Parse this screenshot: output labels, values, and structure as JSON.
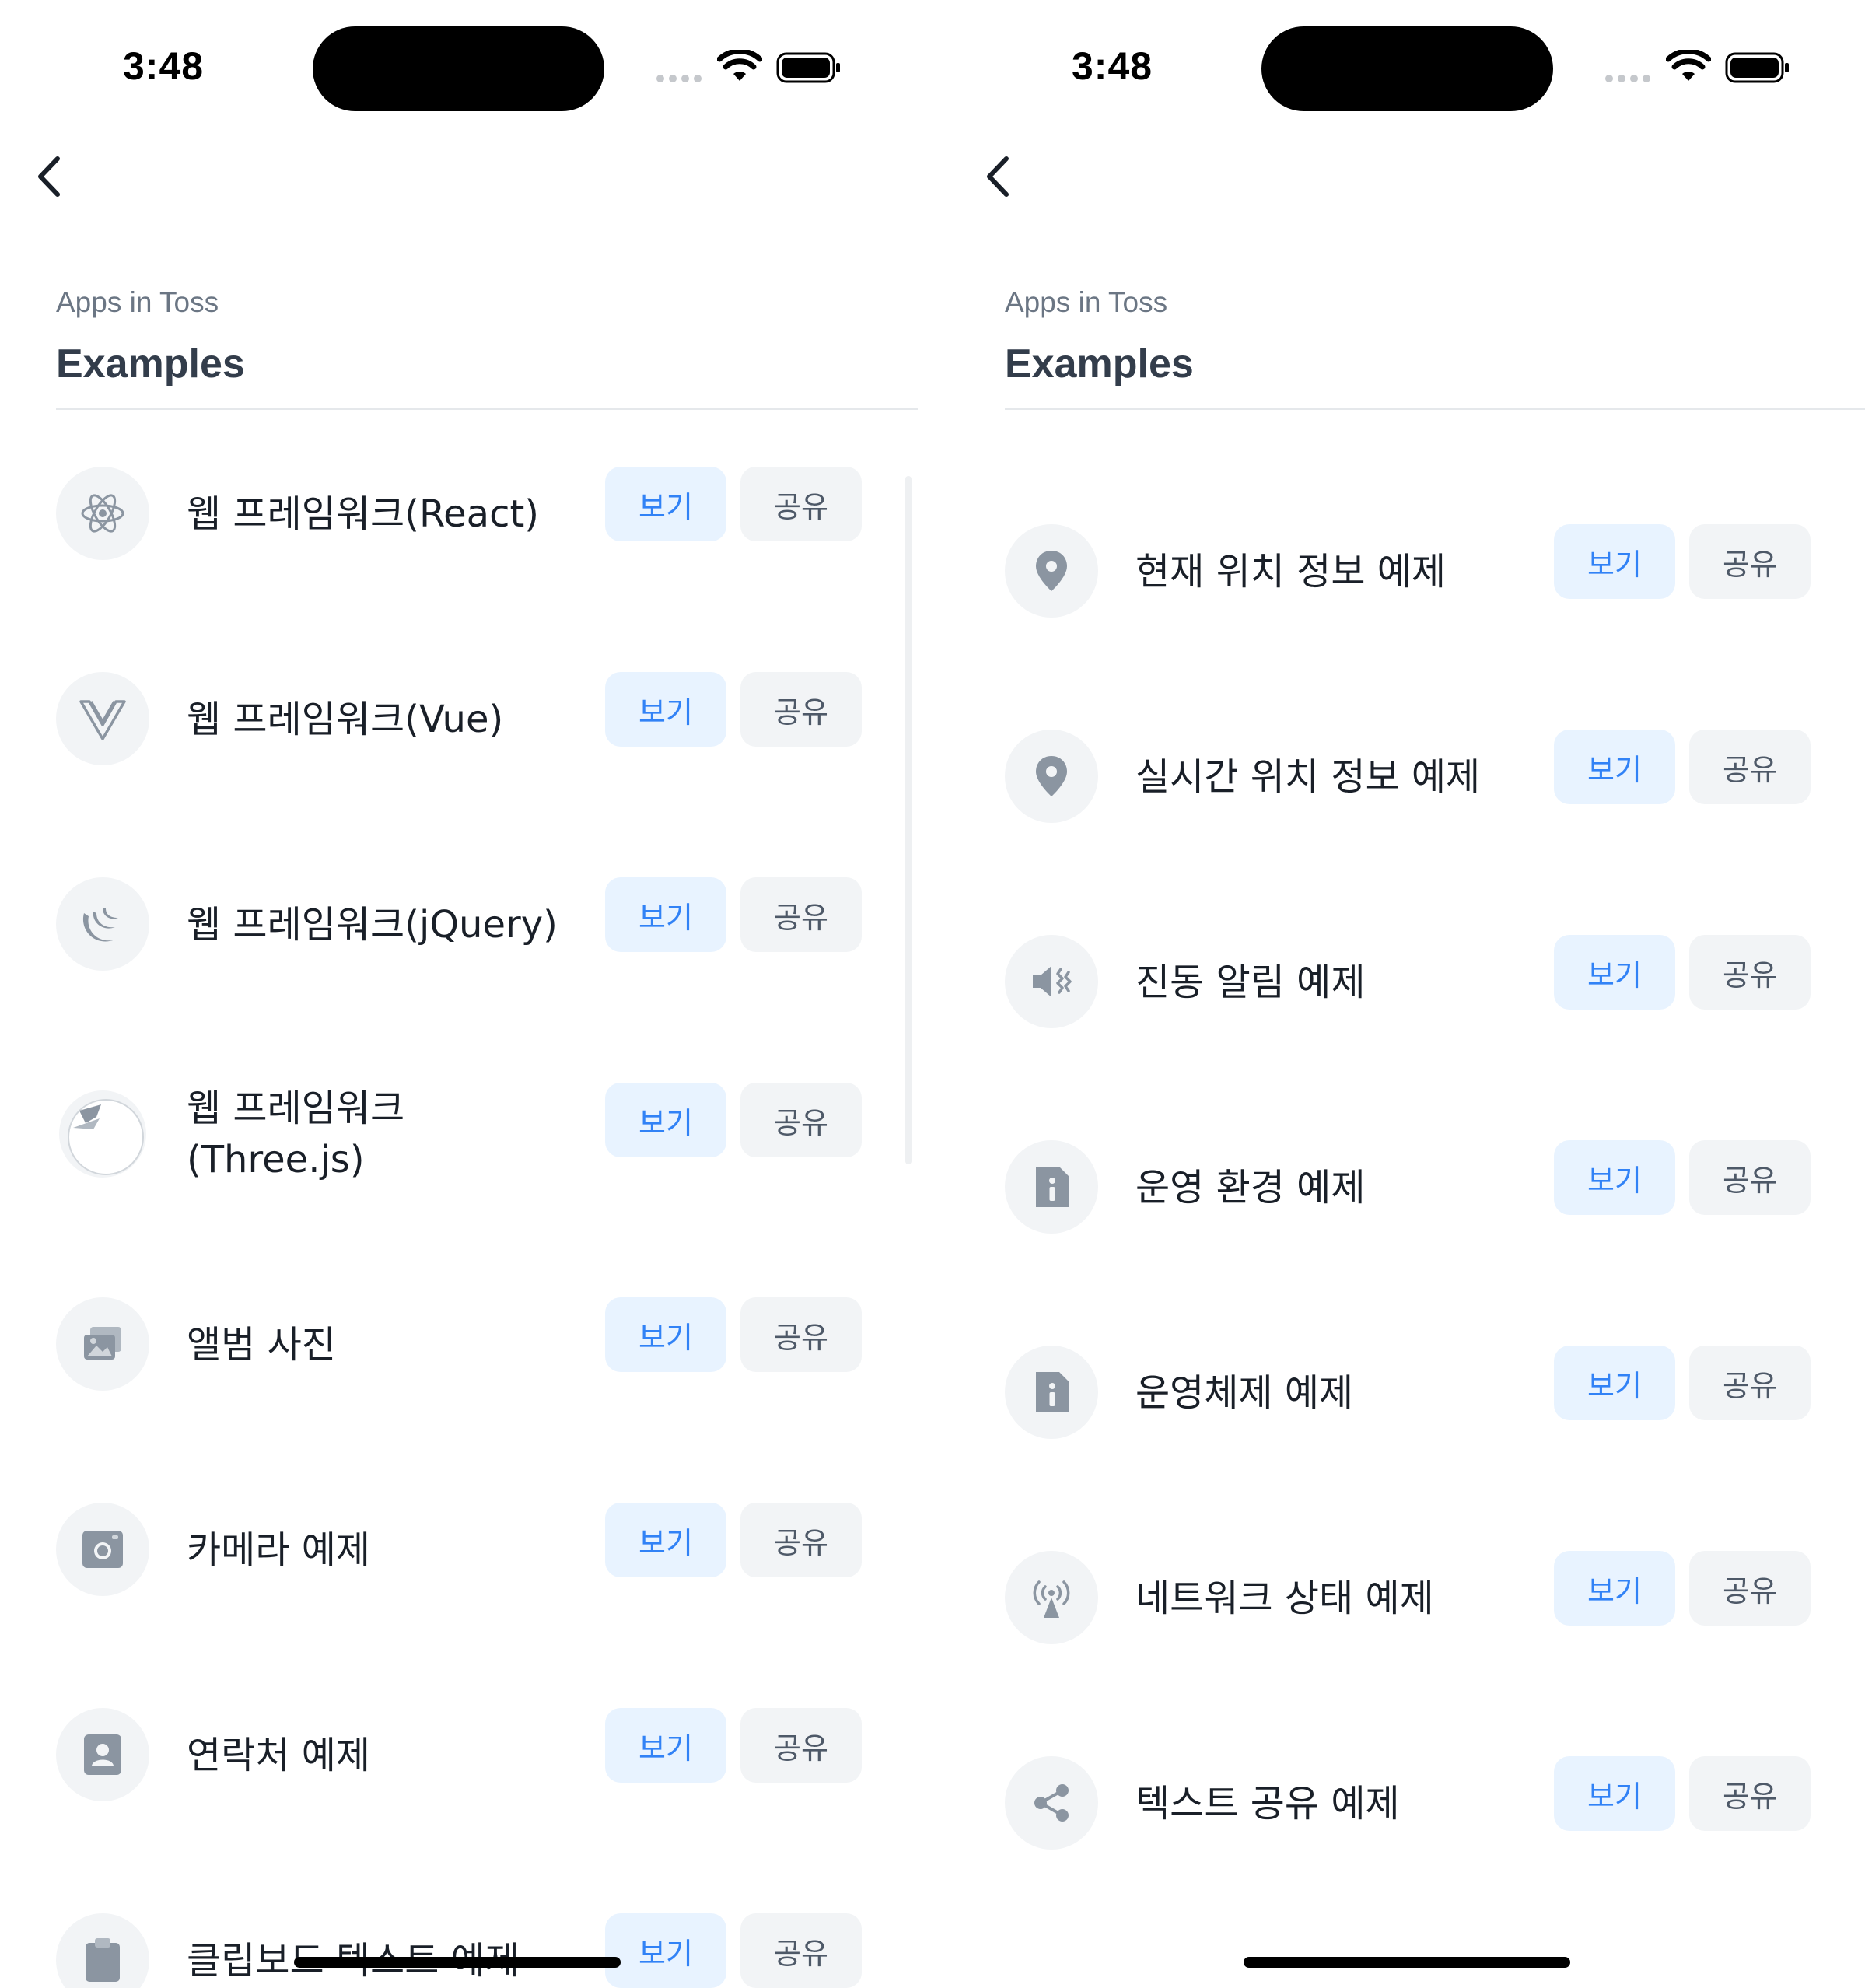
{
  "status": {
    "time": "3:48"
  },
  "header": {
    "subtitle": "Apps in Toss",
    "title": "Examples"
  },
  "buttons": {
    "view": "보기",
    "share": "공유"
  },
  "left": {
    "items": [
      {
        "label": "웹 프레임워크(React)",
        "icon": "react-icon"
      },
      {
        "label": "웹 프레임워크(Vue)",
        "icon": "vue-icon"
      },
      {
        "label": "웹 프레임워크(jQuery)",
        "icon": "jquery-icon"
      },
      {
        "label": "웹 프레임워크\n(Three.js)",
        "icon": "threejs-icon"
      },
      {
        "label": "앨범 사진",
        "icon": "photo-album-icon"
      },
      {
        "label": "카메라 예제",
        "icon": "camera-icon"
      },
      {
        "label": "연락처 예제",
        "icon": "contact-icon"
      },
      {
        "label": "클립보드 텍스트 예제",
        "icon": "clipboard-icon"
      }
    ]
  },
  "right": {
    "items": [
      {
        "label": "현재 위치 정보 예제",
        "icon": "location-pin-icon"
      },
      {
        "label": "실시간 위치 정보 예제",
        "icon": "location-pin-icon"
      },
      {
        "label": "진동 알림 예제",
        "icon": "vibration-icon"
      },
      {
        "label": "운영 환경 예제",
        "icon": "info-icon"
      },
      {
        "label": "운영체제 예제",
        "icon": "info-icon"
      },
      {
        "label": "네트워크 상태 예제",
        "icon": "network-antenna-icon"
      },
      {
        "label": "텍스트 공유 예제",
        "icon": "share-icon"
      }
    ]
  }
}
